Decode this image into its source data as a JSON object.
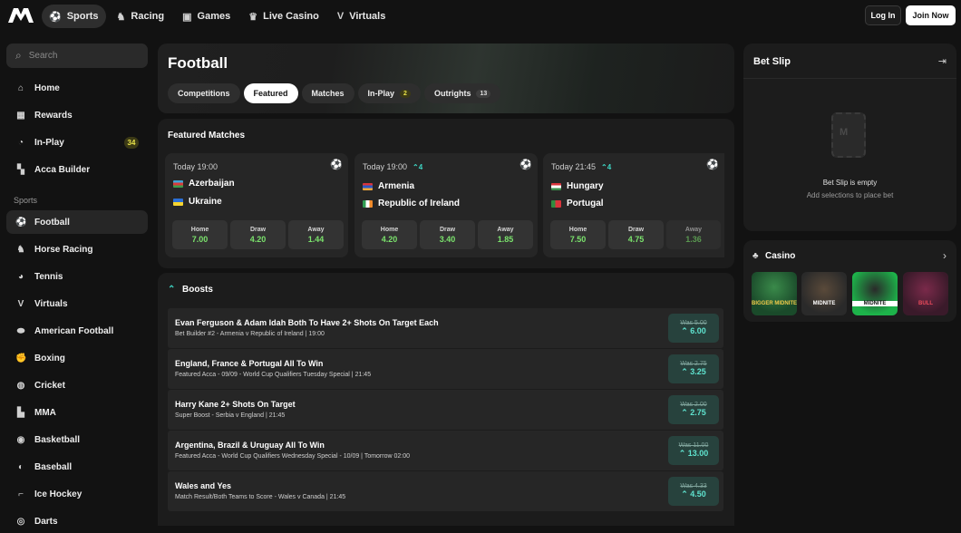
{
  "topnav": {
    "items": [
      {
        "label": "Sports",
        "icon": "football-icon"
      },
      {
        "label": "Racing",
        "icon": "horse-icon"
      },
      {
        "label": "Games",
        "icon": "gamepad-icon"
      },
      {
        "label": "Live Casino",
        "icon": "trophy-icon"
      },
      {
        "label": "Virtuals",
        "icon": "virtuals-icon"
      }
    ],
    "login": "Log In",
    "join": "Join Now"
  },
  "sidebar": {
    "search_placeholder": "Search",
    "items": [
      {
        "label": "Home",
        "icon": "home-icon"
      },
      {
        "label": "Rewards",
        "icon": "gift-icon"
      },
      {
        "label": "In-Play",
        "icon": "live-icon",
        "badge": "34"
      },
      {
        "label": "Acca Builder",
        "icon": "grid-icon"
      }
    ],
    "sports_heading": "Sports",
    "sports": [
      {
        "label": "Football",
        "icon": "football-icon",
        "active": true
      },
      {
        "label": "Horse Racing",
        "icon": "horse-icon"
      },
      {
        "label": "Tennis",
        "icon": "tennis-icon"
      },
      {
        "label": "Virtuals",
        "icon": "virtuals-icon"
      },
      {
        "label": "American Football",
        "icon": "american-football-icon"
      },
      {
        "label": "Boxing",
        "icon": "boxing-glove-icon"
      },
      {
        "label": "Cricket",
        "icon": "cricket-icon"
      },
      {
        "label": "MMA",
        "icon": "mma-icon"
      },
      {
        "label": "Basketball",
        "icon": "basketball-icon"
      },
      {
        "label": "Baseball",
        "icon": "baseball-icon"
      },
      {
        "label": "Ice Hockey",
        "icon": "ice-hockey-icon"
      },
      {
        "label": "Darts",
        "icon": "darts-icon"
      }
    ]
  },
  "header": {
    "title": "Football",
    "tabs": [
      {
        "label": "Competitions"
      },
      {
        "label": "Featured",
        "active": true
      },
      {
        "label": "Matches"
      },
      {
        "label": "In-Play",
        "count": "2"
      },
      {
        "label": "Outrights",
        "count": "13"
      }
    ]
  },
  "featured": {
    "title": "Featured Matches",
    "matches": [
      {
        "time": "Today 19:00",
        "live": "",
        "home": "Azerbaijan",
        "away": "Ukraine",
        "odds": [
          {
            "label": "Home",
            "value": "7.00"
          },
          {
            "label": "Draw",
            "value": "4.20"
          },
          {
            "label": "Away",
            "value": "1.44"
          }
        ]
      },
      {
        "time": "Today 19:00",
        "live": "4",
        "home": "Armenia",
        "away": "Republic of Ireland",
        "odds": [
          {
            "label": "Home",
            "value": "4.20"
          },
          {
            "label": "Draw",
            "value": "3.40"
          },
          {
            "label": "Away",
            "value": "1.85"
          }
        ]
      },
      {
        "time": "Today 21:45",
        "live": "4",
        "home": "Hungary",
        "away": "Portugal",
        "odds": [
          {
            "label": "Home",
            "value": "7.50"
          },
          {
            "label": "Draw",
            "value": "4.75"
          },
          {
            "label": "Away",
            "value": "1.36"
          }
        ]
      }
    ]
  },
  "boosts": {
    "title": "Boosts",
    "items": [
      {
        "title": "Evan Ferguson & Adam Idah Both To Have 2+ Shots On Target Each",
        "sub": "Bet Builder #2 - Armenia v Republic of Ireland | 19:00",
        "was": "Was 5.00",
        "now": "6.00"
      },
      {
        "title": "England, France & Portugal All To Win",
        "sub": "Featured Acca - 09/09 - World Cup Qualifiers Tuesday Special | 21:45",
        "was": "Was 2.75",
        "now": "3.25"
      },
      {
        "title": "Harry Kane 2+ Shots On Target",
        "sub": "Super Boost - Serbia v England | 21:45",
        "was": "Was 2.00",
        "now": "2.75"
      },
      {
        "title": "Argentina, Brazil & Uruguay All To Win",
        "sub": "Featured Acca - World Cup Qualifiers Wednesday Special - 10/09 | Tomorrow 02:00",
        "was": "Was 11.00",
        "now": "13.00"
      },
      {
        "title": "Wales and Yes",
        "sub": "Match Result/Both Teams to Score - Wales v Canada | 21:45",
        "was": "Was 4.33",
        "now": "4.50"
      }
    ]
  },
  "betslip": {
    "title": "Bet Slip",
    "empty": "Bet Slip is empty",
    "hint": "Add selections to place bet"
  },
  "casino": {
    "title": "Casino",
    "games": [
      "BIGGER MIDNITE",
      "MIDNITE",
      "MIDNITE",
      "BULL"
    ]
  },
  "colors": {
    "accent": "#5fe3cf",
    "odds": "#7be36c",
    "badge": "#e8e24a"
  }
}
